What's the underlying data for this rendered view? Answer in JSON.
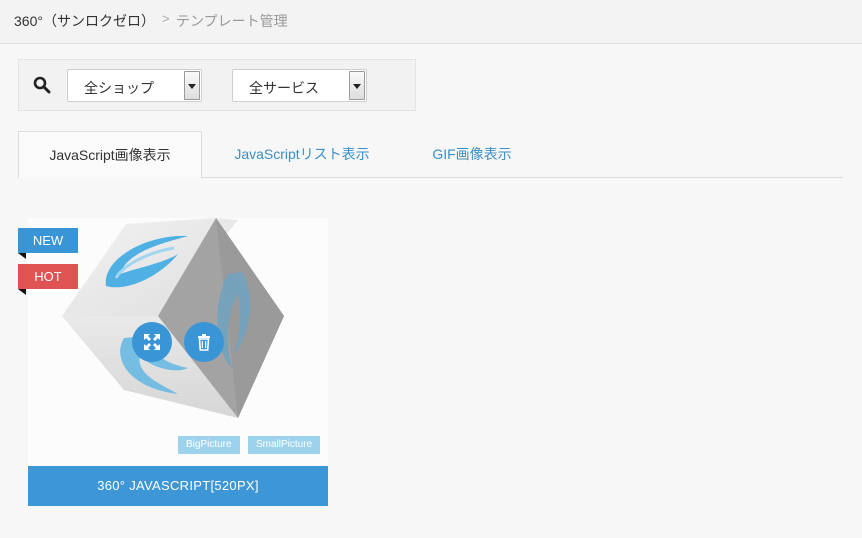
{
  "breadcrumb": {
    "root": "360°（サンロクゼロ）",
    "separator": ">",
    "current": "テンプレート管理"
  },
  "filters": {
    "search_icon": "search-icon",
    "shop_select": {
      "value": "全ショップ"
    },
    "service_select": {
      "value": "全サービス"
    }
  },
  "tabs": [
    {
      "label": "JavaScript画像表示",
      "active": true
    },
    {
      "label": "JavaScriptリスト表示",
      "active": false
    },
    {
      "label": "GIF画像表示",
      "active": false
    }
  ],
  "cards": [
    {
      "badges": [
        "NEW",
        "HOT"
      ],
      "tags": [
        "BigPicture",
        "SmallPicture"
      ],
      "title": "360° JAVASCRIPT[520PX]",
      "icons": [
        "expand-icon",
        "trash-icon"
      ]
    }
  ],
  "colors": {
    "accent": "#3d97d6",
    "new_badge": "#3a95d6",
    "hot_badge": "#e05353",
    "tag": "#9dd2ec"
  }
}
